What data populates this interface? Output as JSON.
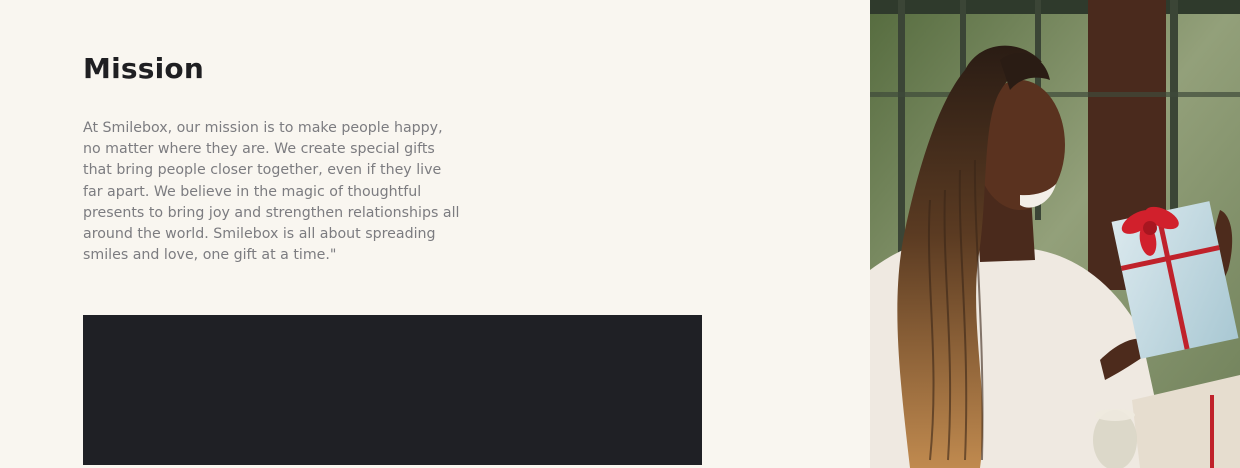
{
  "mission": {
    "title": "Mission",
    "body": "At Smilebox, our mission is to make people happy, no matter where they are. We create special gifts that bring people closer together, even if they live far apart. We believe in the magic of thoughtful presents to bring joy and strengthen relationships all around the world. Smilebox is all about spreading smiles and love, one gift at a time.\""
  },
  "colors": {
    "page_background": "#f9f6f0",
    "title": "#1f1f22",
    "body_text": "#7c7c80",
    "dark_block": "#1f2025"
  }
}
